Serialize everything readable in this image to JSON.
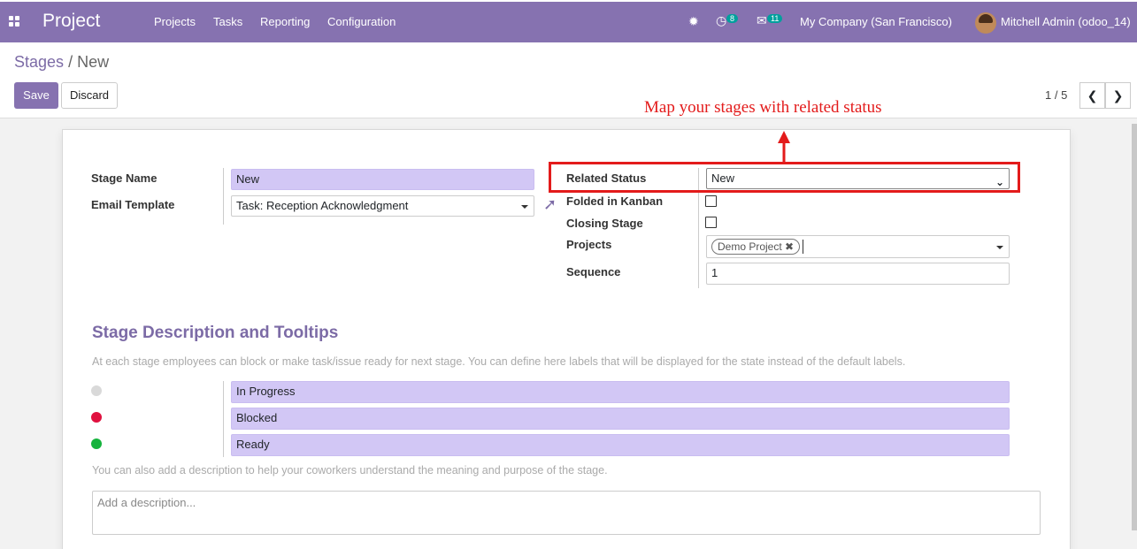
{
  "navbar": {
    "app_title": "Project",
    "menu": [
      "Projects",
      "Tasks",
      "Reporting",
      "Configuration"
    ],
    "activity_count": "8",
    "message_count": "11",
    "company": "My Company (San Francisco)",
    "user": "Mitchell Admin (odoo_14)"
  },
  "breadcrumb": {
    "parent": "Stages",
    "separator": "/",
    "current": "New"
  },
  "buttons": {
    "save": "Save",
    "discard": "Discard"
  },
  "pager": {
    "value": "1 / 5",
    "prev_icon": "chevron-left-icon",
    "next_icon": "chevron-right-icon"
  },
  "annotation": {
    "text": "Map your stages with related status",
    "color": "#e31b1b"
  },
  "form": {
    "stage_name": {
      "label": "Stage Name",
      "value": "New"
    },
    "email_template": {
      "label": "Email Template",
      "value": "Task: Reception Acknowledgment"
    },
    "related_status": {
      "label": "Related Status",
      "value": "New"
    },
    "folded_in_kanban": {
      "label": "Folded in Kanban",
      "checked": false
    },
    "closing_stage": {
      "label": "Closing Stage",
      "checked": false
    },
    "projects": {
      "label": "Projects",
      "tags": [
        "Demo Project"
      ]
    },
    "sequence": {
      "label": "Sequence",
      "value": "1"
    }
  },
  "tooltips": {
    "title": "Stage Description and Tooltips",
    "help": "At each stage employees can block or make task/issue ready for next stage. You can define here labels that will be displayed for the state instead of the default labels.",
    "states": [
      {
        "color": "#d9d9d9",
        "label": "In Progress"
      },
      {
        "color": "#e0113f",
        "label": "Blocked"
      },
      {
        "color": "#15b33d",
        "label": "Ready"
      }
    ],
    "description_help": "You can also add a description to help your coworkers understand the meaning and purpose of the stage.",
    "description_placeholder": "Add a description..."
  },
  "colors": {
    "brand": "#8672b0",
    "required_field": "#d2c7f5",
    "accent_text": "#7c6ba6"
  }
}
